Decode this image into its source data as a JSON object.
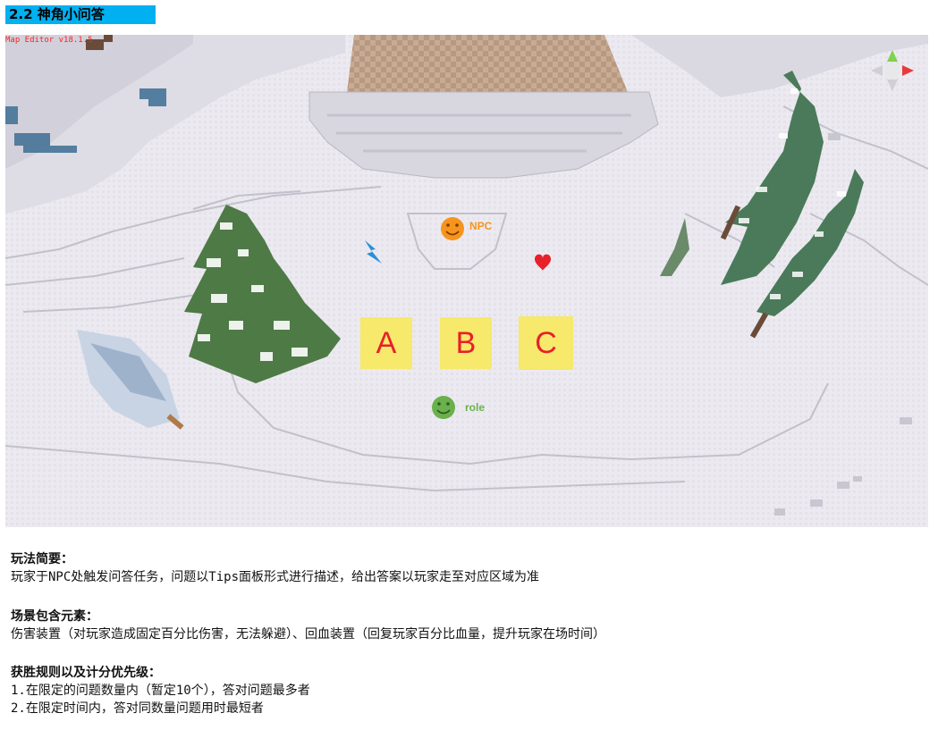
{
  "header": {
    "title": "2.2 神角小问答"
  },
  "scene": {
    "editor_label": "Map Editor v18.1.5",
    "npc_label": "NPC",
    "role_label": "role",
    "answers": [
      "A",
      "B",
      "C"
    ],
    "colors": {
      "snow": "#eceaf0",
      "answer_box": "#f6e96b",
      "answer_text": "#e8202a",
      "npc": "#f7941d",
      "role": "#6ab04c",
      "heart": "#e8202a",
      "lightning": "#2a8fd8",
      "header_bg": "#00b0f0"
    },
    "icons": [
      "npc-face-icon",
      "role-face-icon",
      "heart-icon",
      "lightning-icon",
      "axis-gizmo-icon"
    ]
  },
  "sections": {
    "gameplay": {
      "title": "玩法简要：",
      "lines": [
        "玩家于NPC处触发问答任务，问题以Tips面板形式进行描述，给出答案以玩家走至对应区域为准"
      ]
    },
    "elements": {
      "title": "场景包含元素：",
      "lines": [
        "伤害装置（对玩家造成固定百分比伤害，无法躲避）、回血装置（回复玩家百分比血量，提升玩家在场时间）"
      ]
    },
    "rules": {
      "title": "获胜规则以及计分优先级：",
      "lines": [
        "1.在限定的问题数量内（暂定10个），答对问题最多者",
        "2.在限定时间内，答对同数量问题用时最短者"
      ]
    }
  }
}
